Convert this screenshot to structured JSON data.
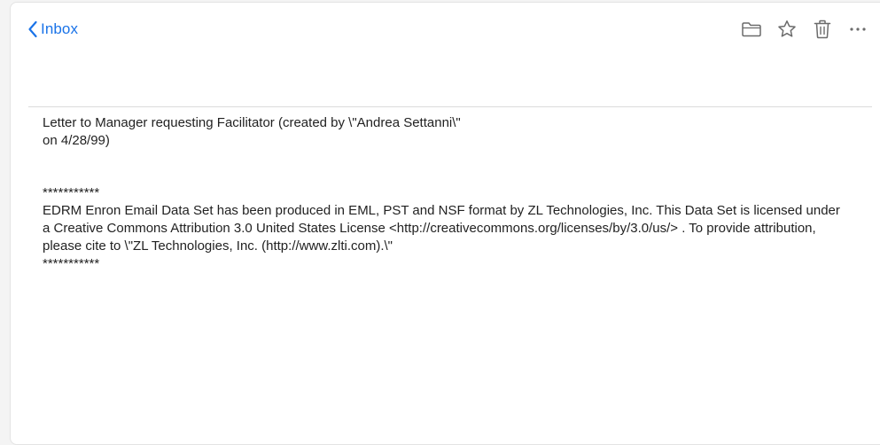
{
  "header": {
    "back_label": "Inbox",
    "actions": [
      {
        "name": "move-to-folder",
        "icon": "folder-icon"
      },
      {
        "name": "star",
        "icon": "star-icon"
      },
      {
        "name": "delete",
        "icon": "trash-icon"
      },
      {
        "name": "more",
        "icon": "more-horizontal-icon"
      }
    ]
  },
  "message": {
    "body_lines": [
      "Letter to Manager requesting Facilitator (created by \\\"Andrea Settanni\\\"",
      "on 4/28/99)"
    ],
    "footer_lines": [
      "***********",
      "EDRM Enron Email Data Set has been produced in EML, PST and NSF format by ZL Technologies, Inc. This Data Set is licensed under a Creative Commons Attribution 3.0 United States License <http://creativecommons.org/licenses/by/3.0/us/> . To provide attribution, please cite to \\\"ZL Technologies, Inc. (http://www.zlti.com).\\\"",
      "***********"
    ]
  },
  "colors": {
    "accent": "#1a73e8",
    "icon": "#6b6b6b",
    "text": "#222222",
    "divider": "#dcdcdc"
  }
}
